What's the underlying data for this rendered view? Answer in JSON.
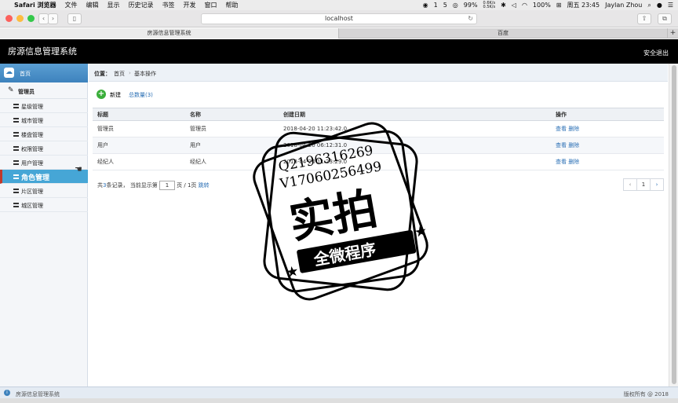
{
  "os_menubar": {
    "app_name": "Safari 浏览器",
    "menus": [
      "文件",
      "编辑",
      "显示",
      "历史记录",
      "书签",
      "开发",
      "窗口",
      "帮助"
    ],
    "status": {
      "notif_count": "1",
      "bell_count": "5",
      "battery_small": "99%",
      "net_up": "0.6K/s",
      "net_down": "0.5K/s",
      "battery": "100%",
      "datetime": "周五 23:45",
      "user": "Jaylan Zhou"
    }
  },
  "browser": {
    "address": "localhost",
    "tabs": [
      "房源信息管理系统",
      "百度"
    ],
    "new_tab": "+"
  },
  "app": {
    "title": "房源信息管理系统",
    "logout": "安全退出"
  },
  "sidebar": {
    "home": "首页",
    "group": "管理员",
    "items": [
      {
        "label": "星级管理"
      },
      {
        "label": "城市管理"
      },
      {
        "label": "楼盘管理"
      },
      {
        "label": "权限管理"
      },
      {
        "label": "用户管理"
      },
      {
        "label": "角色管理"
      },
      {
        "label": "片区管理"
      },
      {
        "label": "城区管理"
      }
    ],
    "active_index": 5
  },
  "breadcrumb": {
    "prefix": "位置：",
    "home": "首页",
    "sep": "›",
    "current": "基本操作"
  },
  "actions": {
    "new": "新建",
    "total": "总数量(3)"
  },
  "table": {
    "headers": [
      "标题",
      "名称",
      "创建日期",
      "操作"
    ],
    "rows": [
      {
        "title": "管理员",
        "name": "管理员",
        "date": "2018-04-20 11:23:42.0",
        "view": "查看",
        "delete": "删除"
      },
      {
        "title": "用户",
        "name": "用户",
        "date": "2018-04-20 06:12:31.0",
        "view": "查看",
        "delete": "删除"
      },
      {
        "title": "经纪人",
        "name": "经纪人",
        "date": "2018-04-20 11:23:29.0",
        "view": "查看",
        "delete": "删除"
      }
    ]
  },
  "pager": {
    "pre1": "共",
    "count": "3",
    "pre2": "条记录，",
    "showing": "当前显示第",
    "page_input": "1",
    "page_of": "页 / 1页",
    "jump": "跳转",
    "prev": "‹",
    "page": "1",
    "next": "›"
  },
  "footer": {
    "left": "房源信息管理系统",
    "right": "版权所有 @ 2018"
  },
  "watermark": {
    "line1": "Q2196316269",
    "line2": "V17060256499",
    "big": "实拍",
    "ribbon": "全微程序"
  }
}
